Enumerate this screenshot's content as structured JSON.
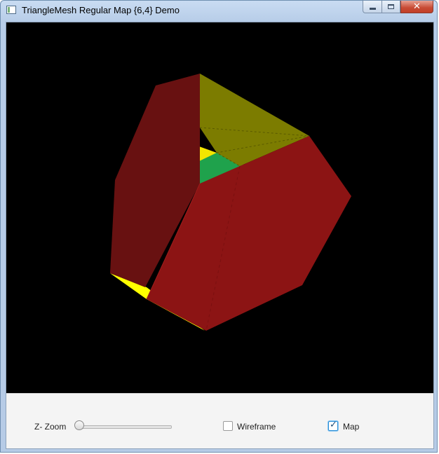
{
  "window": {
    "title": "TriangleMesh Regular Map {6,4} Demo",
    "controls": {
      "minimize": "minimize-icon",
      "maximize": "maximize-icon",
      "close": "close-icon"
    }
  },
  "scene": {
    "background": "#000000",
    "colors": {
      "red_face": "#8f1616",
      "dark_red_face": "#6a1111",
      "olive_face": "#808000",
      "yellow_face": "#ffff00",
      "green_face": "#1f9e4a"
    }
  },
  "controls": {
    "zoom_label": "Z- Zoom",
    "zoom_value": 0,
    "wireframe_label": "Wireframe",
    "wireframe_checked": false,
    "map_label": "Map",
    "map_checked": true
  }
}
